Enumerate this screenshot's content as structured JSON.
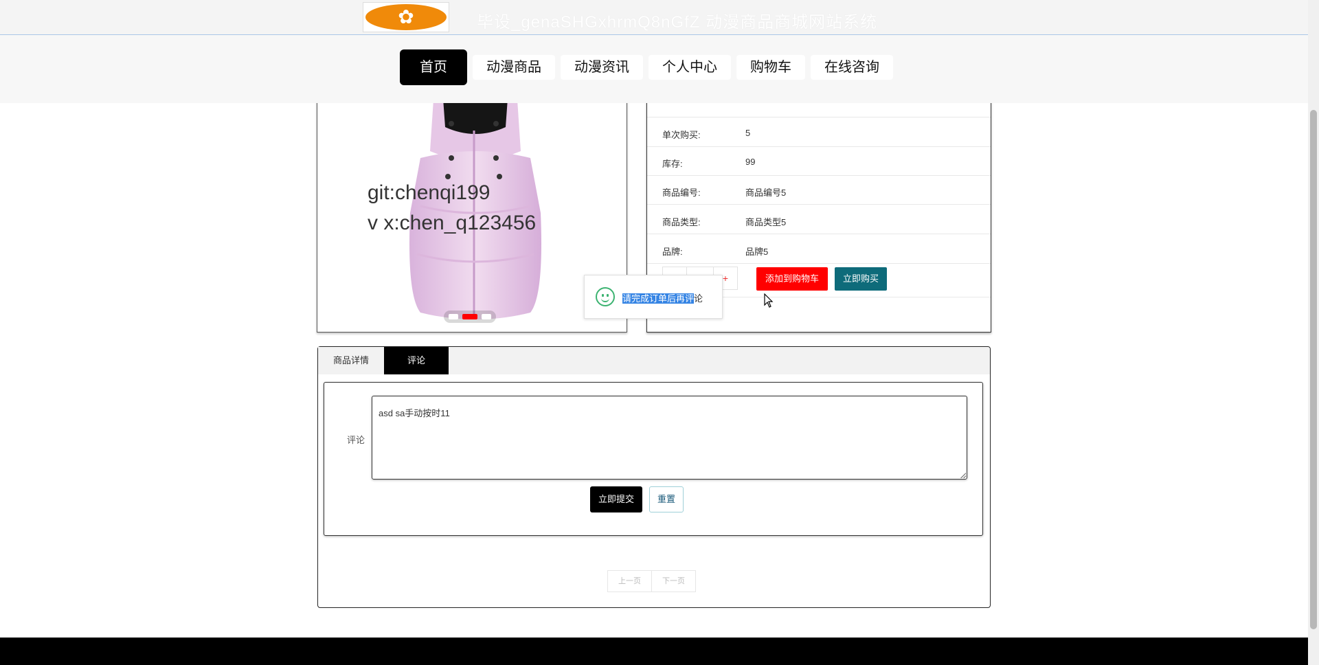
{
  "header": {
    "site_title": "毕设_genaSHGxhrmQ8nGfZ 动漫商品商城网站系统"
  },
  "nav": {
    "items": [
      {
        "label": "首页",
        "active": true
      },
      {
        "label": "动漫商品"
      },
      {
        "label": "动漫资讯"
      },
      {
        "label": "个人中心"
      },
      {
        "label": "购物车"
      },
      {
        "label": "在线咨询"
      }
    ]
  },
  "product": {
    "watermark_1": "git:chenqi199",
    "watermark_2": "v x:chen_q123456",
    "carousel": {
      "count": 3,
      "active_index": 1
    },
    "info": [
      {
        "label": "单次购买:",
        "value": "5"
      },
      {
        "label": "库存:",
        "value": "99"
      },
      {
        "label": "商品编号:",
        "value": "商品编号5"
      },
      {
        "label": "商品类型:",
        "value": "商品类型5"
      },
      {
        "label": "品牌:",
        "value": "品牌5"
      }
    ],
    "qty_minus": "-",
    "qty_plus": "+",
    "add_to_cart": "添加到购物车",
    "buy_now": "立即购买"
  },
  "toast": {
    "text_selected": "请完成订单后再评",
    "text_rest": "论"
  },
  "tabs": [
    {
      "label": "商品详情",
      "active": false
    },
    {
      "label": "评论",
      "active": true
    }
  ],
  "comment": {
    "label": "评论",
    "value": "asd sa手动按时11",
    "submit": "立即提交",
    "reset": "重置"
  },
  "pager": {
    "prev": "上一页",
    "next": "下一页"
  },
  "colors": {
    "accent_red": "#ff0000",
    "accent_teal": "#0e6b7a",
    "logo_orange": "#f08a0a"
  }
}
